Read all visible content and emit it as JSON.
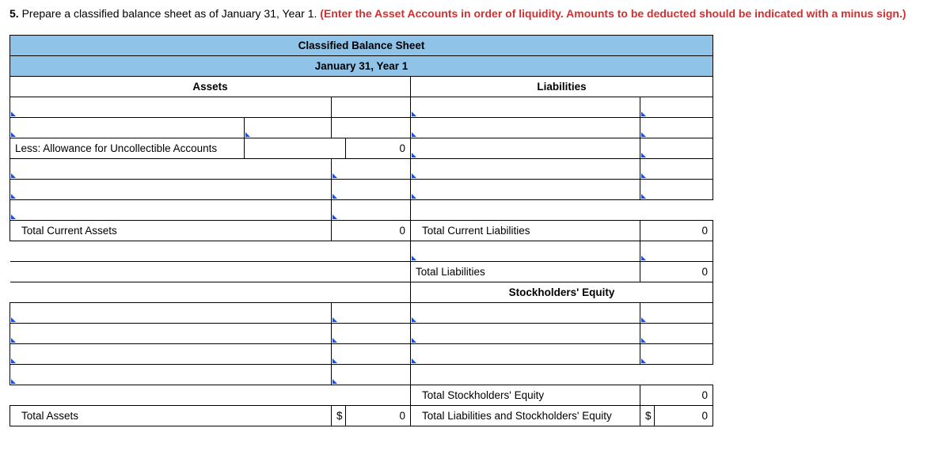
{
  "prompt": {
    "number": "5.",
    "text": "Prepare a classified balance sheet as of January 31, Year 1.",
    "red": "(Enter the Asset Accounts in order of liquidity. Amounts to be deducted should be indicated with a minus sign.)"
  },
  "sheet": {
    "title": "Classified Balance Sheet",
    "date": "January 31, Year 1",
    "assets_header": "Assets",
    "liab_header": "Liabilities",
    "less_allowance": "Less: Allowance for Uncollectible Accounts",
    "total_current_assets": "Total Current Assets",
    "total_assets": "Total Assets",
    "total_current_liab": "Total Current Liabilities",
    "total_liab": "Total Liabilities",
    "se_header": "Stockholders' Equity",
    "total_se": "Total Stockholders' Equity",
    "total_liab_se": "Total Liabilities and Stockholders' Equity",
    "zero": "0",
    "dollar": "$"
  }
}
